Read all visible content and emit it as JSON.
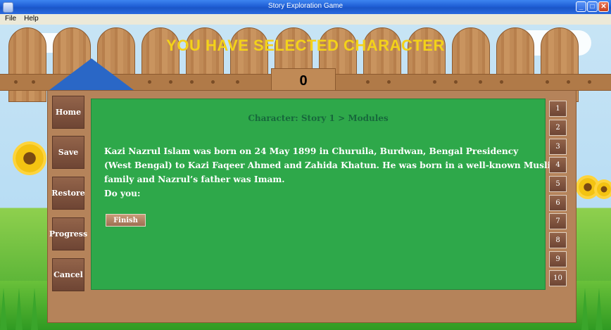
{
  "window": {
    "title": "Story Exploration Game",
    "controls": {
      "minimize": "_",
      "maximize": "□",
      "close": "✕"
    }
  },
  "menu": [
    "File",
    "Help"
  ],
  "scene": {
    "headline": "YOU HAVE SELECTED CHARACTER",
    "score": "0"
  },
  "sidebar": [
    "Home",
    "Save",
    "Restore",
    "Progress",
    "Cancel"
  ],
  "content": {
    "module_title": "Character: Story 1 > Modules",
    "story_lines": [
      "Kazi Nazrul Islam was born on 24 May 1899 in Churuila, Burdwan, Bengal Presidency",
      "(West Bengal) to Kazi Faqeer Ahmed and Zahida Khatun. He was born in a well-known Muslim",
      "family and Nazrul’s father was Imam.",
      "Do you:"
    ],
    "finish_label": "Finish"
  },
  "pages": [
    "1",
    "2",
    "3",
    "4",
    "5",
    "6",
    "7",
    "8",
    "9",
    "10"
  ],
  "colors": {
    "panel_green": "#2ea84a",
    "wood": "#b5835a",
    "headline_yellow": "#f3d21a"
  }
}
